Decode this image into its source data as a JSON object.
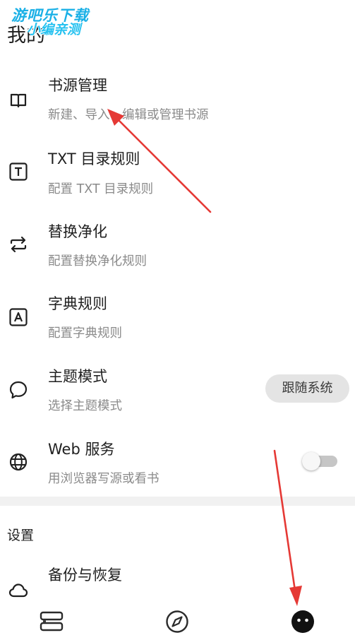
{
  "watermark": {
    "line1": "游吧乐下载",
    "line2": "小编亲测"
  },
  "page": {
    "title": "我的"
  },
  "items": [
    {
      "title": "书源管理",
      "summary": "新建、导入、编辑或管理书源",
      "icon": "book-open-icon"
    },
    {
      "title": "TXT 目录规则",
      "summary": "配置 TXT 目录规则",
      "icon": "text-box-icon"
    },
    {
      "title": "替换净化",
      "summary": "配置替换净化规则",
      "icon": "swap-arrows-icon"
    },
    {
      "title": "字典规则",
      "summary": "配置字典规则",
      "icon": "letter-box-icon"
    },
    {
      "title": "主题模式",
      "summary": "选择主题模式",
      "icon": "speech-bubble-icon",
      "value": "跟随系统"
    },
    {
      "title": "Web 服务",
      "summary": "用浏览器写源或看书",
      "icon": "globe-icon",
      "toggle": false
    }
  ],
  "settings": {
    "header": "设置",
    "items": [
      {
        "title": "备份与恢复",
        "icon": "cloud-icon"
      }
    ]
  },
  "bottom_nav": [
    {
      "name": "bookshelf",
      "icon": "bookshelf-icon"
    },
    {
      "name": "explore",
      "icon": "compass-icon"
    },
    {
      "name": "my",
      "icon": "face-icon",
      "active": true
    }
  ],
  "annotations": {
    "color": "#e53935"
  }
}
